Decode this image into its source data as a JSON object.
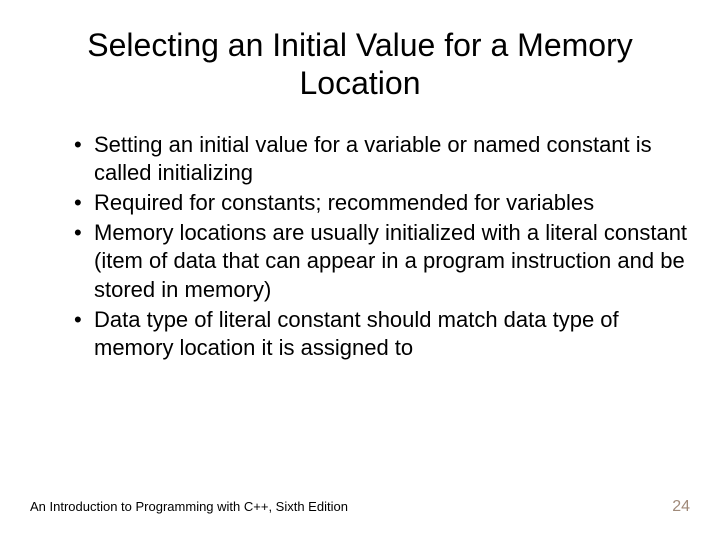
{
  "title": "Selecting an Initial Value for a Memory Location",
  "bullets": [
    "Setting an initial value for a variable or named constant is called initializing",
    "Required for constants; recommended for variables",
    "Memory locations are usually initialized with a literal constant (item of data that can appear in a program instruction and be stored in memory)",
    "Data type of literal constant should match data type of memory location it is assigned to"
  ],
  "footer": {
    "text": "An Introduction to Programming with C++, Sixth Edition",
    "page": "24"
  }
}
